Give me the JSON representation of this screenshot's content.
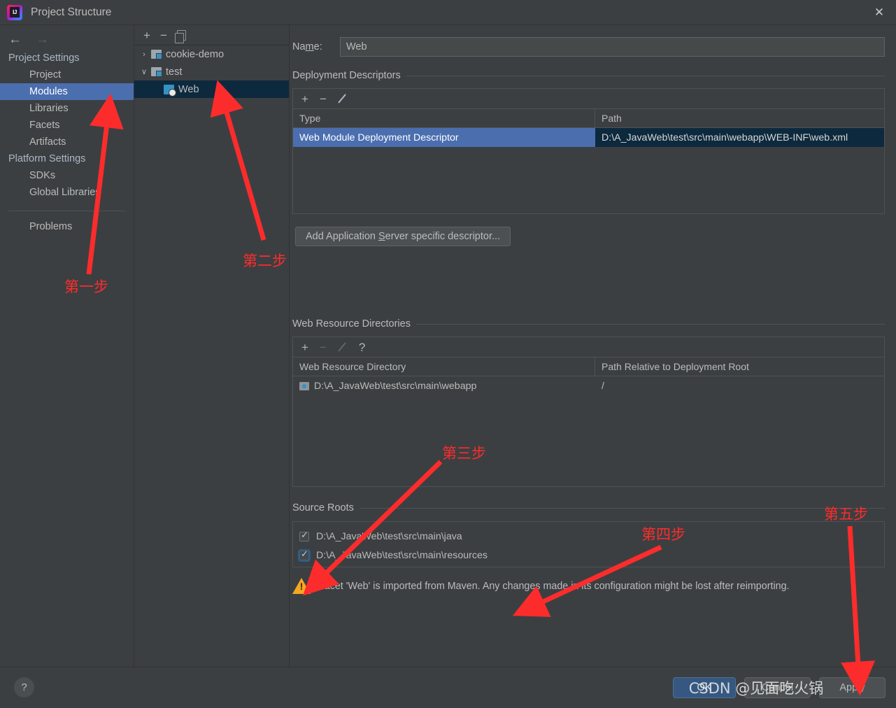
{
  "window": {
    "title": "Project Structure",
    "app_icon": "intellij-idea-logo",
    "close_label": "✕"
  },
  "nav": {
    "back_icon": "←",
    "forward_icon": "→"
  },
  "sidebar": {
    "groups": [
      {
        "label": "Project Settings",
        "items": [
          {
            "label": "Project",
            "selected": false
          },
          {
            "label": "Modules",
            "selected": true
          },
          {
            "label": "Libraries",
            "selected": false
          },
          {
            "label": "Facets",
            "selected": false
          },
          {
            "label": "Artifacts",
            "selected": false
          }
        ]
      },
      {
        "label": "Platform Settings",
        "items": [
          {
            "label": "SDKs",
            "selected": false
          },
          {
            "label": "Global Libraries",
            "selected": false
          }
        ]
      }
    ],
    "problems_label": "Problems"
  },
  "tree": {
    "toolbar": {
      "add": "+",
      "remove": "−",
      "copy": "copy-icon"
    },
    "nodes": [
      {
        "label": "cookie-demo",
        "twisty": "›",
        "icon": "module-icon",
        "indent": 0,
        "selected": false
      },
      {
        "label": "test",
        "twisty": "∨",
        "icon": "module-icon",
        "indent": 0,
        "selected": false
      },
      {
        "label": "Web",
        "twisty": "",
        "icon": "web-facet-icon",
        "indent": 1,
        "selected": true
      }
    ]
  },
  "detail": {
    "name_label_pre": "Na",
    "name_label_mnemonic": "m",
    "name_label_post": "e:",
    "name_value": "Web",
    "deployment_descriptors": {
      "title": "Deployment Descriptors",
      "toolbar": {
        "add": "+",
        "remove": "−",
        "edit": "edit-pencil-icon"
      },
      "columns": [
        "Type",
        "Path"
      ],
      "rows": [
        {
          "type": "Web Module Deployment Descriptor",
          "path": "D:\\A_JavaWeb\\test\\src\\main\\webapp\\WEB-INF\\web.xml",
          "selected": true
        }
      ]
    },
    "add_descriptor_button": {
      "pre": "Add Application ",
      "mnemonic": "S",
      "post": "erver specific descriptor..."
    },
    "web_resource_directories": {
      "title": "Web Resource Directories",
      "toolbar": {
        "add": "+",
        "remove": "−",
        "edit": "edit-pencil-icon",
        "help": "?"
      },
      "columns": [
        "Web Resource Directory",
        "Path Relative to Deployment Root"
      ],
      "rows": [
        {
          "directory": "D:\\A_JavaWeb\\test\\src\\main\\webapp",
          "relative_path": "/",
          "selected": false
        }
      ]
    },
    "source_roots": {
      "title": "Source Roots",
      "items": [
        {
          "path": "D:\\A_JavaWeb\\test\\src\\main\\java",
          "checked": true,
          "focused": false
        },
        {
          "path": "D:\\A_JavaWeb\\test\\src\\main\\resources",
          "checked": true,
          "focused": true
        }
      ]
    },
    "warning": {
      "icon": "warning-triangle-icon",
      "text": "Facet 'Web' is imported from Maven. Any changes made in its configuration might be lost after reimporting."
    }
  },
  "footer": {
    "help": "?",
    "ok": "OK",
    "cancel": "Cancel",
    "apply": "Apply"
  },
  "annotations": {
    "accent_color": "#fd2c2c",
    "steps": [
      {
        "label": "第一步"
      },
      {
        "label": "第二步"
      },
      {
        "label": "第三步"
      },
      {
        "label": "第四步"
      },
      {
        "label": "第五步"
      }
    ],
    "watermark": "CSDN @见面吃火锅"
  },
  "colors": {
    "background": "#3c3f41",
    "selection_blue": "#4b6eaf",
    "tree_selection": "#0d293e",
    "primary_button": "#365880",
    "warning": "#f5a623",
    "annotation_red": "#fd2c2c"
  }
}
